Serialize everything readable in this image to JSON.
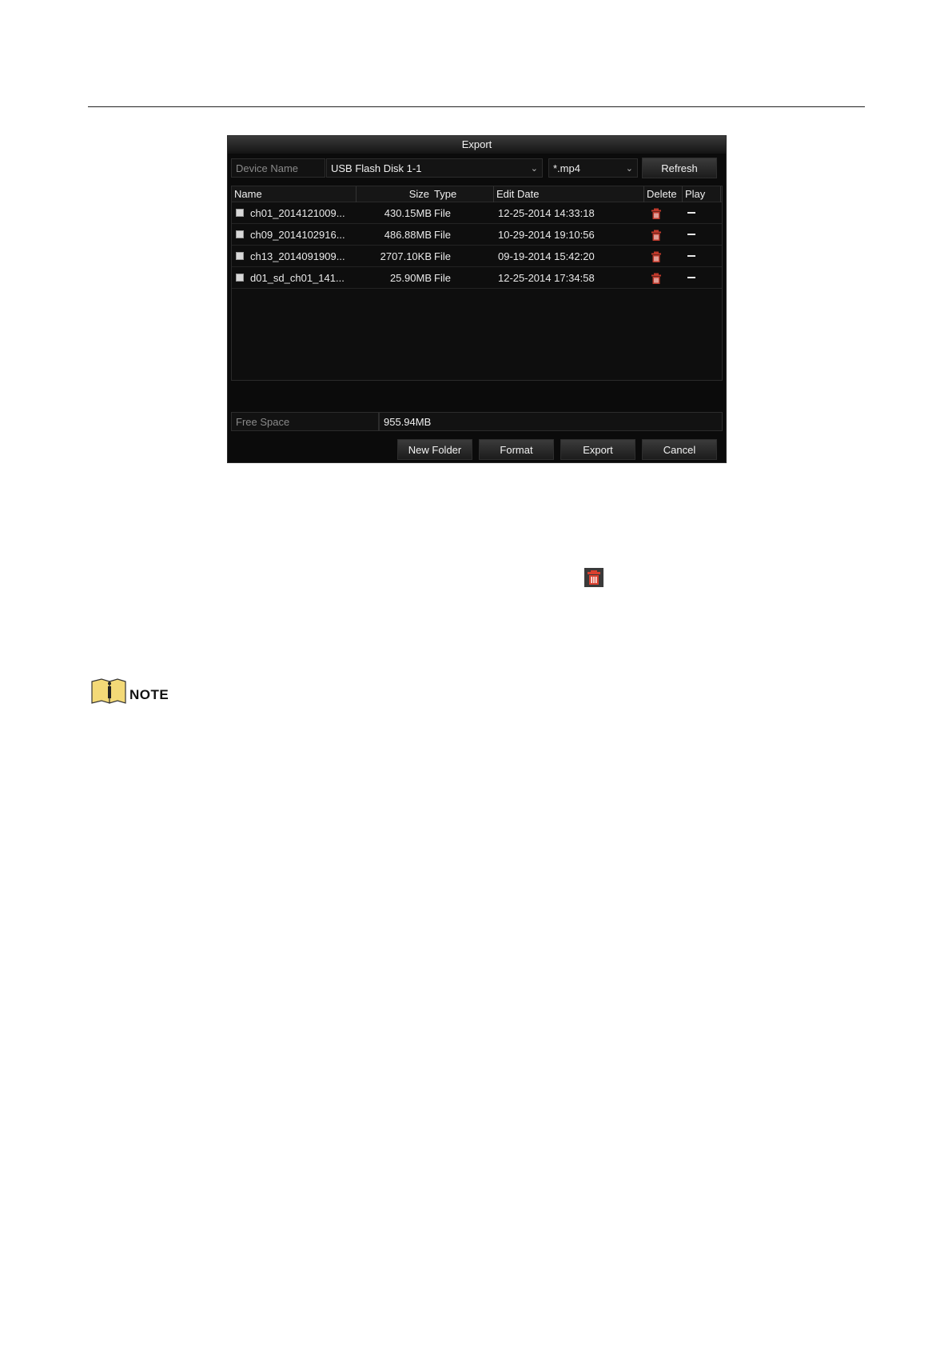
{
  "dialog": {
    "title": "Export",
    "device_name_label": "Device Name",
    "device_name_value": "USB Flash Disk 1-1",
    "file_type_value": "*.mp4",
    "refresh_label": "Refresh",
    "columns": {
      "name": "Name",
      "size": "Size",
      "type": "Type",
      "edit_date": "Edit Date",
      "delete": "Delete",
      "play": "Play"
    },
    "files": [
      {
        "name": "ch01_2014121009...",
        "size": "430.15MB",
        "type": "File",
        "edit_date": "12-25-2014 14:33:18"
      },
      {
        "name": "ch09_2014102916...",
        "size": "486.88MB",
        "type": "File",
        "edit_date": "10-29-2014 19:10:56"
      },
      {
        "name": "ch13_2014091909...",
        "size": "2707.10KB",
        "type": "File",
        "edit_date": "09-19-2014 15:42:20"
      },
      {
        "name": "d01_sd_ch01_141...",
        "size": "25.90MB",
        "type": "File",
        "edit_date": "12-25-2014 17:34:58"
      }
    ],
    "free_space_label": "Free Space",
    "free_space_value": "955.94MB",
    "buttons": {
      "new_folder": "New Folder",
      "format": "Format",
      "export": "Export",
      "cancel": "Cancel"
    }
  },
  "note": {
    "label": "NOTE"
  },
  "colors": {
    "dialog_bg": "#0b0b0b",
    "trash_red": "#c0392b",
    "note_yellow": "#f3d977"
  }
}
